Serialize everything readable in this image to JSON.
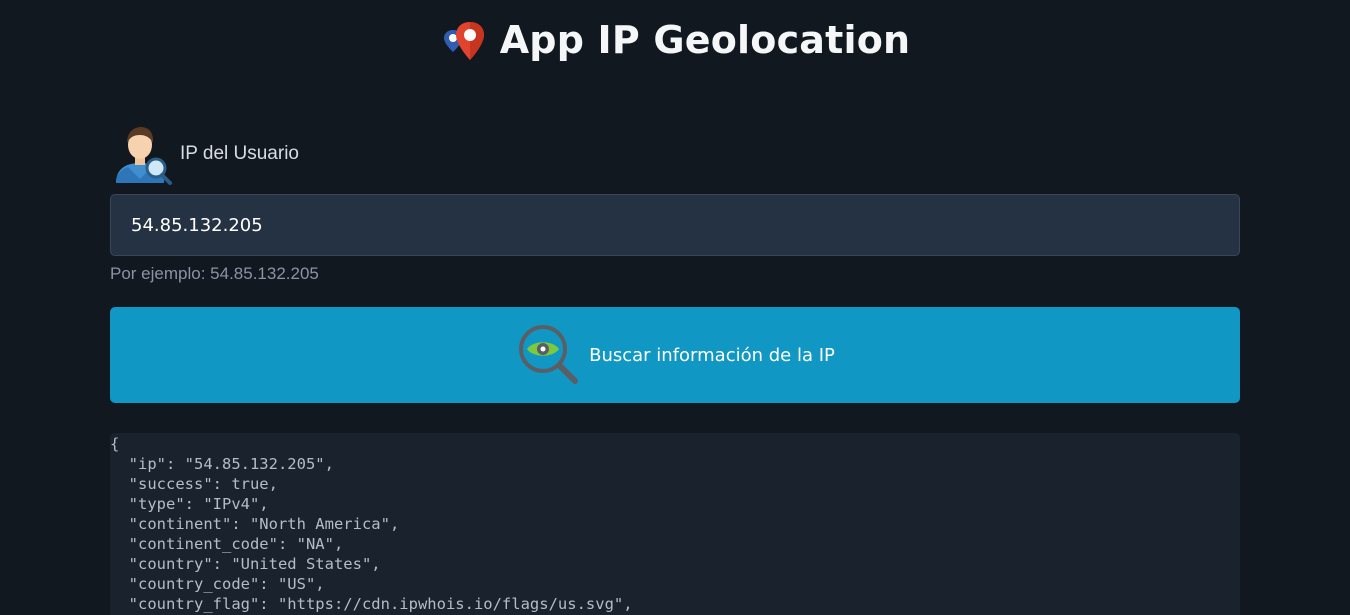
{
  "header": {
    "title": "App IP Geolocation",
    "logo_icon": "location-pins-icon"
  },
  "form": {
    "label": "IP del Usuario",
    "label_icon": "user-search-icon",
    "ip_value": "54.85.132.205",
    "helper": "Por ejemplo: 54.85.132.205",
    "button_label": "Buscar información de la IP",
    "button_icon": "eye-search-icon"
  },
  "colors": {
    "background": "#121820",
    "input_bg": "#253244",
    "button_bg": "#1097c3",
    "result_bg": "#1a232d"
  },
  "result": {
    "json_text": "{\n  \"ip\": \"54.85.132.205\",\n  \"success\": true,\n  \"type\": \"IPv4\",\n  \"continent\": \"North America\",\n  \"continent_code\": \"NA\",\n  \"country\": \"United States\",\n  \"country_code\": \"US\",\n  \"country_flag\": \"https://cdn.ipwhois.io/flags/us.svg\","
  }
}
